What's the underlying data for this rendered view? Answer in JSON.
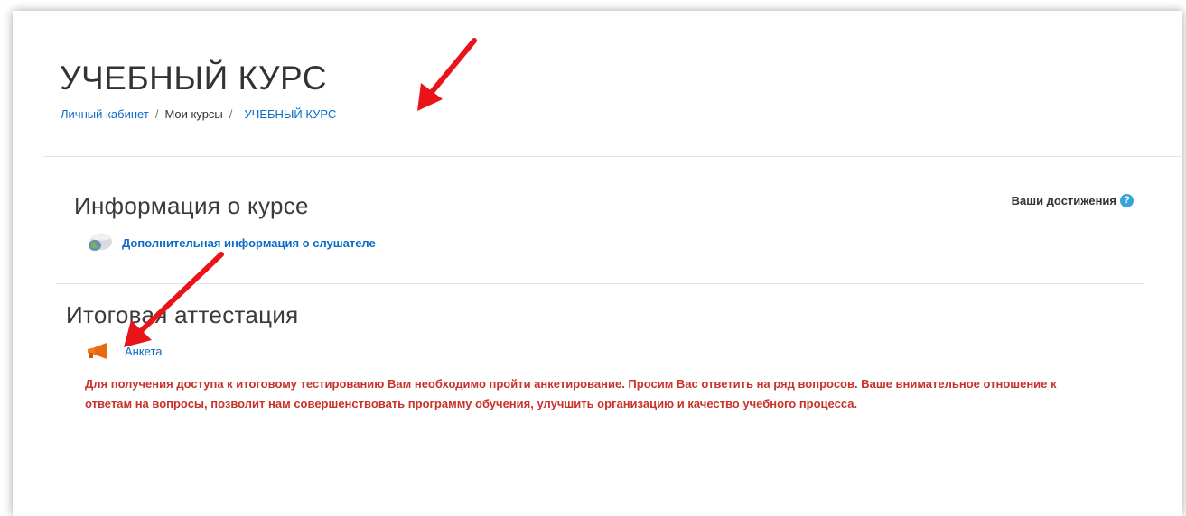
{
  "page": {
    "title": "УЧЕБНЫЙ КУРС"
  },
  "breadcrumb": {
    "items": [
      {
        "label": "Личный кабинет"
      },
      {
        "label": "Мои курсы"
      },
      {
        "label": "УЧЕБНЫЙ КУРС"
      }
    ],
    "separator": "/"
  },
  "achievements": {
    "label": "Ваши достижения",
    "help_glyph": "?",
    "icon": "help-icon"
  },
  "sections": [
    {
      "title": "Информация о курсе",
      "activity": {
        "label": "Дополнительная информация о слушателе",
        "icon": "database-icon"
      }
    },
    {
      "title": "Итоговая аттестация",
      "activity": {
        "label": "Анкета",
        "icon": "megaphone-icon"
      },
      "notice": "Для получения доступа к итоговому тестированию Вам необходимо пройти анкетирование. Просим Вас ответить на ряд вопросов. Ваше внимательное отношение к ответам на вопросы, позволит нам совершенствовать программу обучения, улучшить организацию и качество учебного процесса."
    }
  ],
  "colors": {
    "link": "#0a6cc7",
    "notice": "#c8322b",
    "annotation_arrow": "#e8141a",
    "help_icon": "#38a3d8"
  }
}
